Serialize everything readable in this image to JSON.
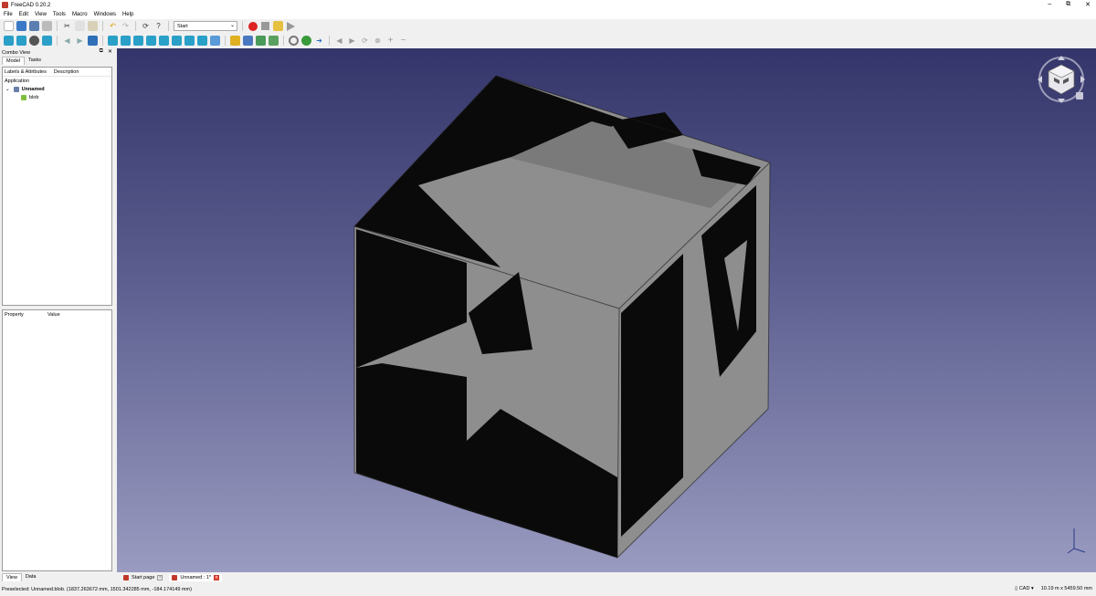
{
  "window": {
    "title": "FreeCAD 0.20.2",
    "controls": [
      "–",
      "⧉",
      "✕"
    ]
  },
  "menu": [
    "File",
    "Edit",
    "View",
    "Tools",
    "Macro",
    "Windows",
    "Help"
  ],
  "toolbar": {
    "workbench": "Start"
  },
  "combo_view": {
    "title": "Combo View",
    "tabs": [
      "Model",
      "Tasks"
    ],
    "tree_headers": [
      "Labels & Attributes",
      "Description"
    ],
    "tree": {
      "root": "Application",
      "document": "Unnamed",
      "object": "blob"
    },
    "property_headers": [
      "Property",
      "Value"
    ],
    "bottom_tabs": [
      "View",
      "Data"
    ]
  },
  "document_tabs": [
    {
      "label": "Start page",
      "active": false
    },
    {
      "label": "Unnamed : 1*",
      "active": true
    }
  ],
  "status": {
    "message": "Preselected: Unnamed.blob. (1837.263672 mm, 1501.342285 mm, -184.174149 mm)",
    "nav_style": "CAD",
    "dimensions": "10.19 m x 5459.50 mm"
  },
  "colors": {
    "viewport_top": "#34356a",
    "viewport_bottom": "#9a9bc0",
    "cube_light": "#8e8e8e",
    "cube_dark": "#0a0a0a",
    "record": "#dd2222"
  }
}
